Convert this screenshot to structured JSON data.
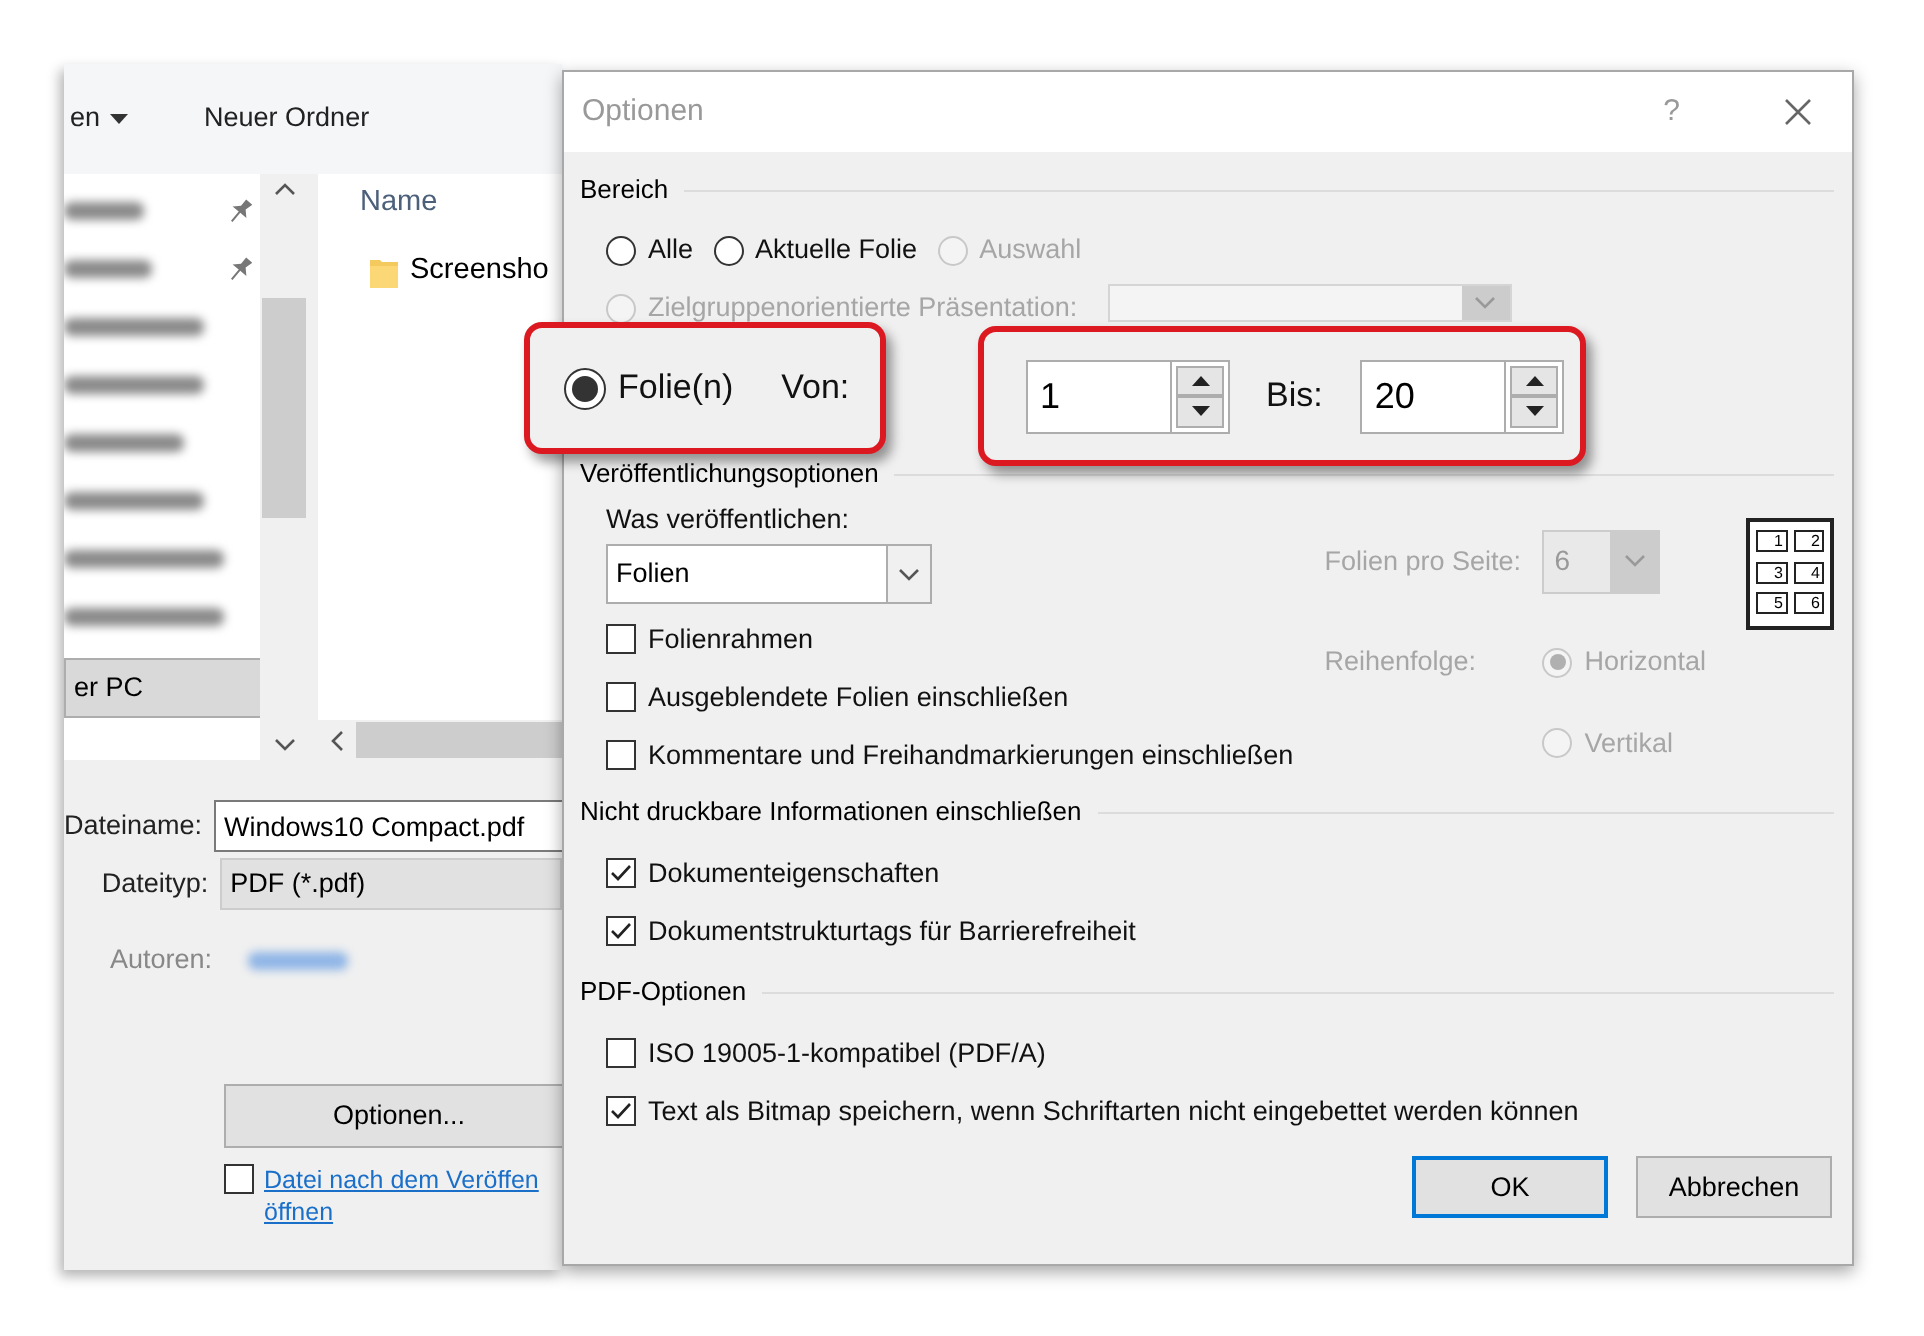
{
  "file_dialog": {
    "toolbar": [
      {
        "label": "en",
        "dropdown": true
      },
      {
        "label": "Neuer Ordner",
        "dropdown": false
      }
    ],
    "sidebar": {
      "items": [
        {
          "kind": "blurred",
          "pinned": true,
          "selected": false
        },
        {
          "kind": "blurred",
          "pinned": true,
          "selected": false
        },
        {
          "kind": "blurred",
          "pinned": false,
          "selected": false
        },
        {
          "kind": "blurred",
          "pinned": false,
          "selected": false
        },
        {
          "kind": "blurred",
          "pinned": false,
          "selected": false
        },
        {
          "kind": "blurred",
          "pinned": false,
          "selected": false
        },
        {
          "kind": "blurred",
          "pinned": false,
          "selected": false
        },
        {
          "kind": "blurred",
          "pinned": false,
          "selected": false
        },
        {
          "kind": "text",
          "label": "er PC",
          "pinned": false,
          "selected": true
        }
      ]
    },
    "column_header": "Name",
    "files": [
      {
        "name": "Screensho"
      }
    ],
    "fields": [
      {
        "kind": "input",
        "label": "Dateiname:",
        "value": "Windows10 Compact.pdf"
      },
      {
        "kind": "select",
        "label": "Dateityp:",
        "value": "PDF (*.pdf)"
      },
      {
        "kind": "blurred",
        "label": "Autoren:"
      }
    ],
    "options_button": "Optionen...",
    "open_after": {
      "lines": [
        "Datei nach dem Veröffen",
        "öffnen"
      ],
      "checked": false
    }
  },
  "options_dialog": {
    "title": "Optionen",
    "help": "?",
    "range": {
      "heading": "Bereich",
      "radios": [
        {
          "label": "Alle",
          "selected": false,
          "disabled": false
        },
        {
          "label": "Aktuelle Folie",
          "selected": false,
          "disabled": false
        },
        {
          "label": "Auswahl",
          "selected": false,
          "disabled": true
        }
      ],
      "audience": {
        "label": "Zielgruppenorientierte Präsentation:",
        "selected": false,
        "disabled": true
      }
    },
    "callouts": {
      "slides_radio": {
        "label": "Folie(n)",
        "selected": true
      },
      "from_label": "Von:",
      "from_value": "1",
      "to_label": "Bis:",
      "to_value": "20"
    },
    "publish": {
      "heading": "Veröffentlichungsoptionen",
      "what_label": "Was veröffentlichen:",
      "what_value": "Folien",
      "checkboxes": [
        {
          "label": "Folienrahmen",
          "checked": false
        },
        {
          "label": "Ausgeblendete Folien einschließen",
          "checked": false
        },
        {
          "label": "Kommentare und Freihandmarkierungen einschließen",
          "checked": false
        }
      ],
      "per_page_label": "Folien pro Seite:",
      "per_page_value": "6",
      "per_page_disabled": true,
      "order_label": "Reihenfolge:",
      "order": [
        {
          "label": "Horizontal",
          "selected": true,
          "disabled": true
        },
        {
          "label": "Vertikal",
          "selected": false,
          "disabled": true
        }
      ],
      "layout_preview": [
        "1",
        "2",
        "3",
        "4",
        "5",
        "6"
      ]
    },
    "non_printable": {
      "heading": "Nicht druckbare Informationen einschließen",
      "checkboxes": [
        {
          "label": "Dokumenteigenschaften",
          "checked": true
        },
        {
          "label": "Dokumentstrukturtags für Barrierefreiheit",
          "checked": true
        }
      ]
    },
    "pdf": {
      "heading": "PDF-Optionen",
      "checkboxes": [
        {
          "label": "ISO 19005-1-kompatibel (PDF/A)",
          "checked": false
        },
        {
          "label": "Text als Bitmap speichern, wenn Schriftarten nicht eingebettet werden können",
          "checked": true
        }
      ]
    },
    "buttons": [
      {
        "label": "OK",
        "default": true
      },
      {
        "label": "Abbrechen",
        "default": false
      }
    ]
  }
}
